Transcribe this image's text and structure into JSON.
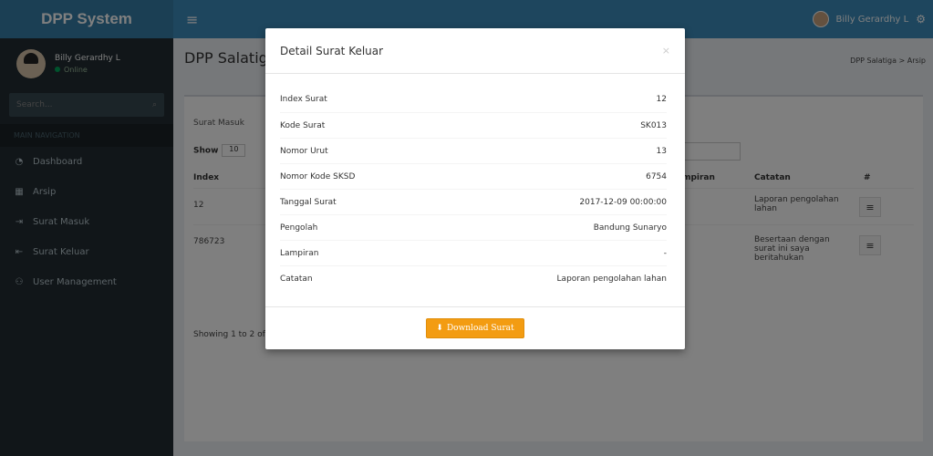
{
  "topbar": {
    "brand": "DPP System",
    "menu_glyph": "≡",
    "user_name": "Billy Gerardhy L",
    "gear_glyph": "⚙"
  },
  "sidebar": {
    "user_name": "Billy Gerardhy L",
    "status": "Online",
    "search_placeholder": "Search...",
    "header": "MAIN NAVIGATION",
    "items": [
      {
        "label": "Dashboard",
        "icon": "dashboard-icon",
        "glyph": "◔"
      },
      {
        "label": "Arsip",
        "icon": "archive-icon",
        "glyph": "▦"
      },
      {
        "label": "Surat Masuk",
        "icon": "sign-in-icon",
        "glyph": "⇥"
      },
      {
        "label": "Surat Keluar",
        "icon": "sign-out-icon",
        "glyph": "⇤"
      },
      {
        "label": "User Management",
        "icon": "users-icon",
        "glyph": "⚇"
      }
    ]
  },
  "content": {
    "page_title": "DPP Salatiga",
    "breadcrumb": "DPP Salatiga > Arsip",
    "tab": "Surat Masuk",
    "show_label": "Show",
    "show_value": "10",
    "columns": [
      "Index",
      "ampiran",
      "Catatan",
      "#"
    ],
    "rows": [
      {
        "index": "12",
        "catatan": "Laporan pengolahan lahan"
      },
      {
        "index": "786723",
        "catatan": "Besertaan dengan surat ini saya beritahukan"
      }
    ],
    "showing": "Showing 1 to 2 of 2"
  },
  "modal": {
    "title": "Detail Surat Keluar",
    "close_glyph": "×",
    "fields": [
      {
        "label": "Index Surat",
        "value": "12"
      },
      {
        "label": "Kode Surat",
        "value": "SK013"
      },
      {
        "label": "Nomor Urut",
        "value": "13"
      },
      {
        "label": "Nomor Kode SKSD",
        "value": "6754"
      },
      {
        "label": "Tanggal Surat",
        "value": "2017-12-09 00:00:00"
      },
      {
        "label": "Pengolah",
        "value": "Bandung Sunaryo"
      },
      {
        "label": "Lampiran",
        "value": "-"
      },
      {
        "label": "Catatan",
        "value": "Laporan pengolahan lahan"
      }
    ],
    "download_label": "Download Surat",
    "download_glyph": "⬇"
  },
  "colors": {
    "navbar": "#3c8dbc",
    "sidebar": "#222d32",
    "download": "#f39c12"
  }
}
